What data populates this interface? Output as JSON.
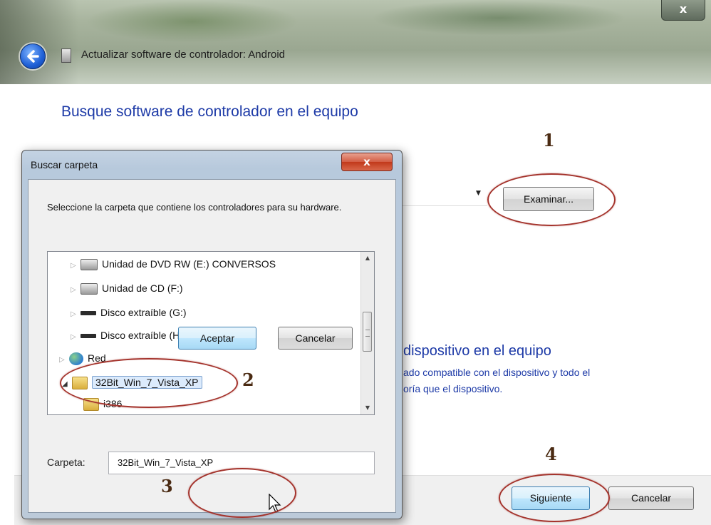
{
  "window": {
    "title": "Actualizar software de controlador: Android",
    "close_label": "x"
  },
  "main": {
    "heading": "Busque software de controlador en el equipo",
    "browse_button": "Examinar...",
    "option2": {
      "title": "dispositivo en el equipo",
      "line1": "ado compatible con el dispositivo y todo el",
      "line2": "oría que el dispositivo."
    },
    "next_button": "Siguiente",
    "cancel_button": "Cancelar"
  },
  "dialog": {
    "title": "Buscar carpeta",
    "close_label": "x",
    "instruction": "Seleccione la carpeta que contiene los controladores para su hardware.",
    "tree": [
      {
        "label": "Unidad de DVD RW (E:) CONVERSOS",
        "icon": "drive-icon"
      },
      {
        "label": "Unidad de CD (F:)",
        "icon": "drive-icon"
      },
      {
        "label": "Disco extraíble (G:)",
        "icon": "usb-drive-icon"
      },
      {
        "label": "Disco extraíble (H:)",
        "icon": "usb-drive-icon"
      },
      {
        "label": "Red",
        "icon": "network-icon"
      },
      {
        "label": "32Bit_Win_7_Vista_XP",
        "icon": "folder-icon",
        "selected": true
      },
      {
        "label": "i386",
        "icon": "folder-icon"
      }
    ],
    "folder_label": "Carpeta:",
    "folder_value": "32Bit_Win_7_Vista_XP",
    "ok_button": "Aceptar",
    "cancel_button": "Cancelar"
  },
  "annotations": {
    "step1": "1",
    "step2": "2",
    "step3": "3",
    "step4": "4",
    "color": "#a4332c"
  }
}
